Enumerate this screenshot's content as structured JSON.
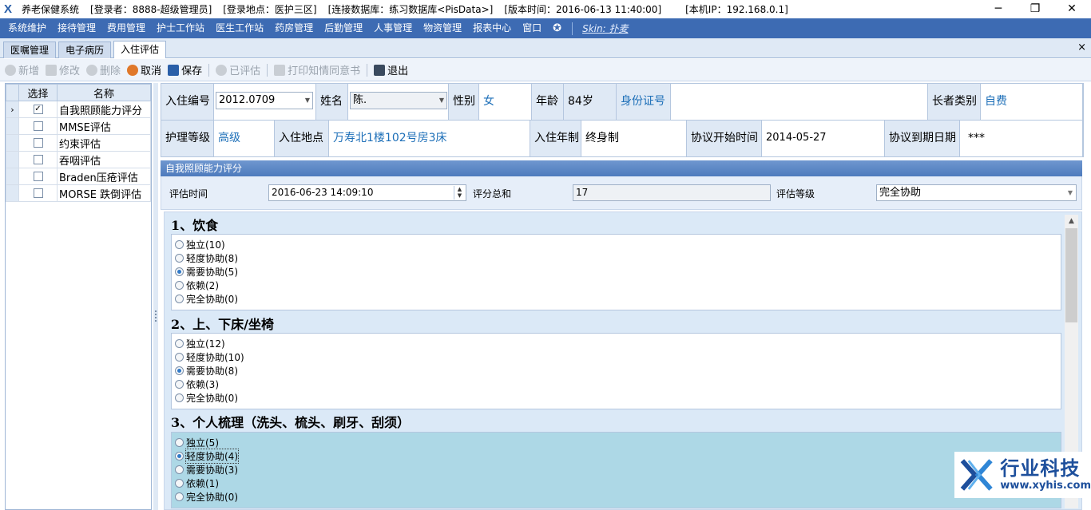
{
  "titlebar": {
    "app_name": "养老保健系统",
    "login_user": "[登录者：8888-超级管理员]",
    "login_location": "[登录地点：医护三区]",
    "database": "[连接数据库：练习数据库<PisData>]",
    "version": "[版本时间：2016-06-13 11:40:00]",
    "local_ip": "[本机IP：192.168.0.1]",
    "minimize": "─",
    "restore": "❐",
    "close": "✕"
  },
  "menubar": {
    "items": [
      "系统维护",
      "接待管理",
      "费用管理",
      "护士工作站",
      "医生工作站",
      "药房管理",
      "后勤管理",
      "人事管理",
      "物资管理",
      "报表中心",
      "窗口"
    ],
    "skin_label": "Skin: 扑麦"
  },
  "tabs": {
    "items": [
      "医嘱管理",
      "电子病历",
      "入住评估"
    ],
    "active": "入住评估",
    "close": "×"
  },
  "toolbar": {
    "add": "新增",
    "edit": "修改",
    "delete": "删除",
    "cancel": "取消",
    "save": "保存",
    "evaluated": "已评估",
    "print_consent": "打印知情同意书",
    "exit": "退出"
  },
  "left_list": {
    "col_select": "选择",
    "col_name": "名称",
    "rows": [
      {
        "checked": true,
        "name": "自我照顾能力评分",
        "current": true
      },
      {
        "checked": false,
        "name": "MMSE评估"
      },
      {
        "checked": false,
        "name": "约束评估"
      },
      {
        "checked": false,
        "name": "吞咽评估"
      },
      {
        "checked": false,
        "name": "Braden压疮评估"
      },
      {
        "checked": false,
        "name": "MORSE 跌倒评估"
      }
    ]
  },
  "info": {
    "admission_no_label": "入住编号",
    "admission_no": "2012.0709",
    "name_label": "姓名",
    "name": "陈.",
    "gender_label": "性别",
    "gender": "女",
    "age_label": "年龄",
    "age": "84岁",
    "id_card_label": "身份证号",
    "id_card": "",
    "elder_type_label": "长者类别",
    "elder_type": "自费",
    "care_level_label": "护理等级",
    "care_level": "高级",
    "location_label": "入住地点",
    "location": "万寿北1楼102号房3床",
    "term_label": "入住年制",
    "term": "终身制",
    "start_label": "协议开始时间",
    "start_date": "2014-05-27",
    "end_label": "协议到期日期",
    "end_date": "***"
  },
  "assessment": {
    "group_title": "自我照顾能力评分",
    "time_label": "评估时间",
    "time_value": "2016-06-23 14:09:10",
    "total_label": "评分总和",
    "total_value": "17",
    "grade_label": "评估等级",
    "grade_value": "完全协助"
  },
  "questions": [
    {
      "title": "1、饮食",
      "options": [
        "独立(10)",
        "轻度协助(8)",
        "需要协助(5)",
        "依赖(2)",
        "完全协助(0)"
      ],
      "selected": 2
    },
    {
      "title": "2、上、下床/坐椅",
      "options": [
        "独立(12)",
        "轻度协助(10)",
        "需要协助(8)",
        "依赖(3)",
        "完全协助(0)"
      ],
      "selected": 2
    },
    {
      "title": "3、个人梳理（洗头、梳头、刷牙、刮须）",
      "options": [
        "独立(5)",
        "轻度协助(4)",
        "需要协助(3)",
        "依赖(1)",
        "完全协助(0)"
      ],
      "selected": 1
    }
  ],
  "watermark": {
    "brand": "行业科技",
    "url": "www.xyhis.com"
  },
  "colors": {
    "menubar": "#3d6bb3",
    "accent_text": "#1d6fb8",
    "selected_group": "#add8e6",
    "header_gradient": "#4e7bbd"
  }
}
